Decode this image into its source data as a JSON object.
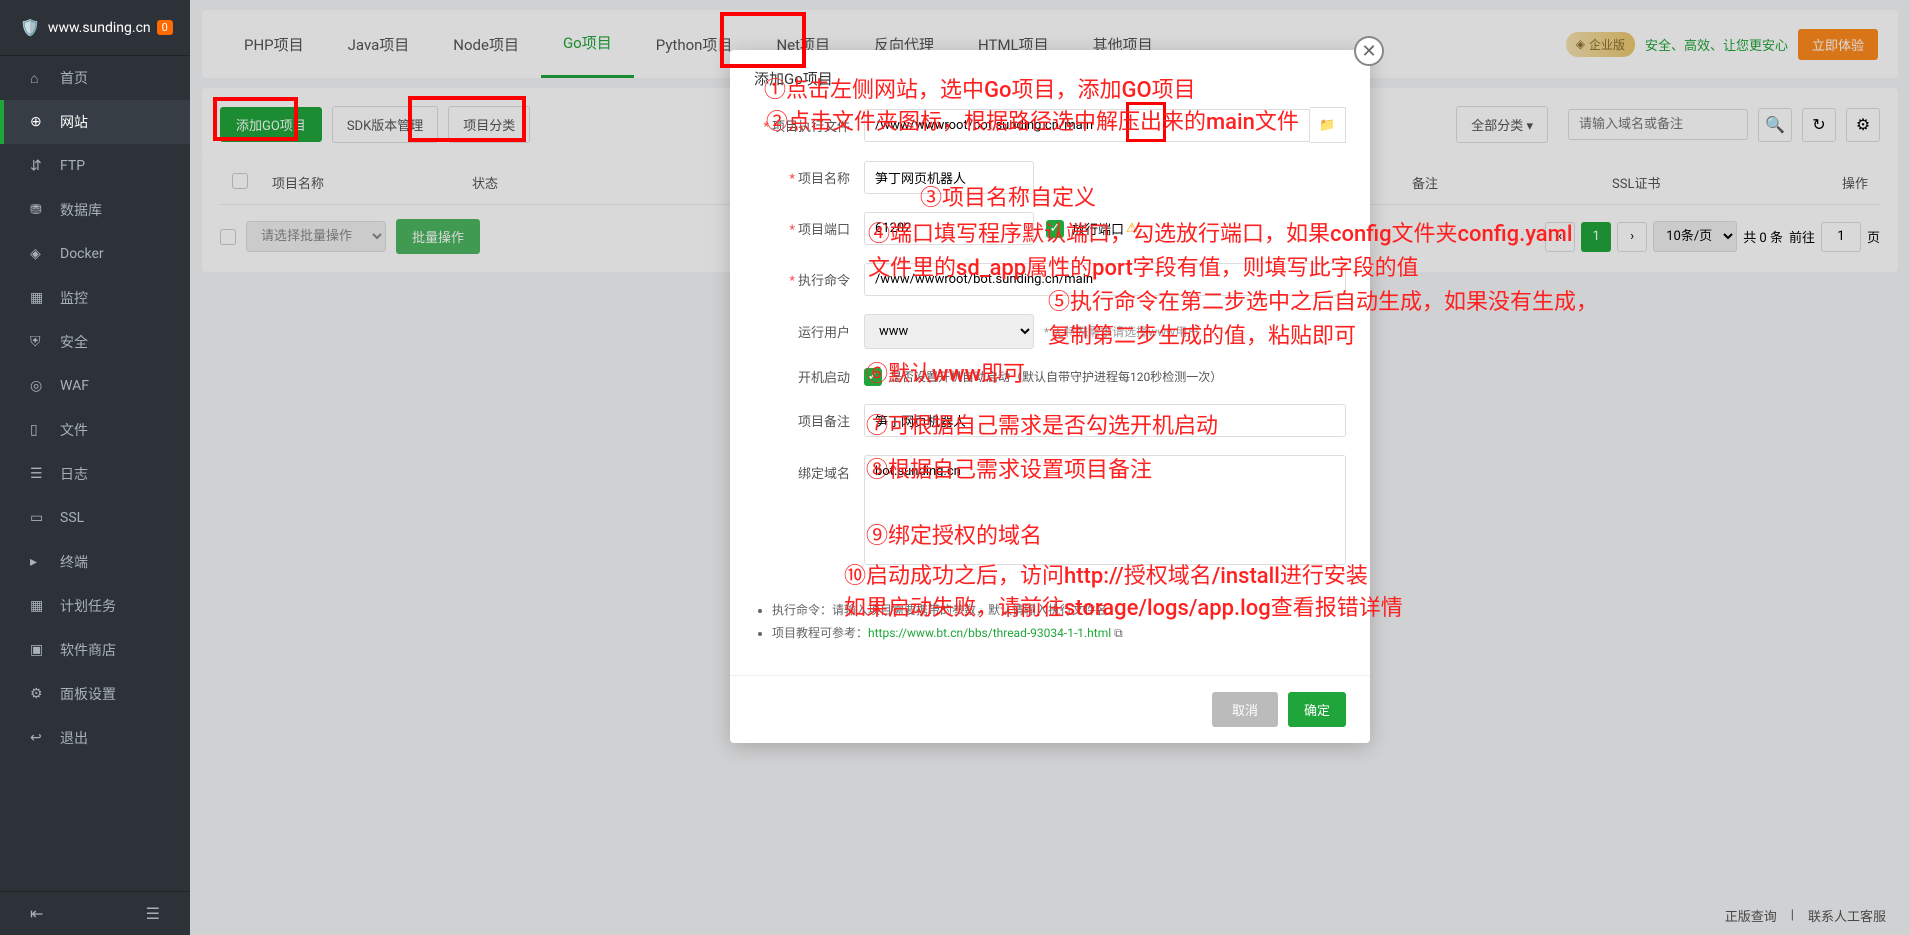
{
  "header": {
    "site": "www.sunding.cn",
    "badge": "0"
  },
  "sidebar": {
    "items": [
      {
        "label": "首页"
      },
      {
        "label": "网站"
      },
      {
        "label": "FTP"
      },
      {
        "label": "数据库"
      },
      {
        "label": "Docker"
      },
      {
        "label": "监控"
      },
      {
        "label": "安全"
      },
      {
        "label": "WAF"
      },
      {
        "label": "文件"
      },
      {
        "label": "日志"
      },
      {
        "label": "SSL"
      },
      {
        "label": "终端"
      },
      {
        "label": "计划任务"
      },
      {
        "label": "软件商店"
      },
      {
        "label": "面板设置"
      },
      {
        "label": "退出"
      }
    ]
  },
  "tabs": [
    "PHP项目",
    "Java项目",
    "Node项目",
    "Go项目",
    "Python项目",
    "Net项目",
    "反向代理",
    "HTML项目",
    "其他项目"
  ],
  "promo": {
    "badge": "企业版",
    "text": "安全、高效、让您更安心",
    "btn": "立即体验"
  },
  "toolbar": {
    "add": "添加GO项目",
    "sdk": "SDK版本管理",
    "cat": "项目分类",
    "allcat": "全部分类",
    "search_ph": "请输入域名或备注"
  },
  "table": {
    "headers": [
      "项目名称",
      "状态",
      "备注",
      "SSL证书",
      "操作"
    ]
  },
  "batch": {
    "ph": "请选择批量操作",
    "btn": "批量操作"
  },
  "pager": {
    "size": "10条/页",
    "total": "共 0 条",
    "goto": "前往",
    "page": "1",
    "unit": "页"
  },
  "modal": {
    "title": "添加Go项目",
    "labels": {
      "exec": "项目执行文件",
      "name": "项目名称",
      "port": "项目端口",
      "cmd": "执行命令",
      "user": "运行用户",
      "boot": "开机启动",
      "remark": "项目备注",
      "domain": "绑定域名"
    },
    "values": {
      "exec": "/www/wwwroot/bot.sunding.cn/main",
      "name": "笋丁网页机器人",
      "port": "61202",
      "port_chk": "放行端口",
      "cmd": "/www/wwwroot/bot.sunding.cn/main",
      "user": "www",
      "user_hint": "* 无特殊需求请选择www用户",
      "boot_hint": "是否设置开机自动启动（默认自带守护进程每120秒检测一次）",
      "remark": "笋丁网页机器人",
      "domain": "bot.sunding.cn"
    },
    "notes": {
      "n1": "执行命令：请输入项目需要携带的参数，默认请输入执行文件名",
      "n2": "项目教程可参考：",
      "link": "https://www.bt.cn/bbs/thread-93034-1-1.html"
    },
    "cancel": "取消",
    "confirm": "确定"
  },
  "anno": {
    "a1": "①点击左侧网站，选中Go项目，添加GO项目",
    "a2": "②点击文件夹图标，根据路径选中解压出来的main文件",
    "a3": "③项目名称自定义",
    "a4a": "④端口填写程序默认端口，勾选放行端口，如果config文件夹config.yaml",
    "a4b": "文件里的sd_app属性的port字段有值，则填写此字段的值",
    "a5a": "⑤执行命令在第二步选中之后自动生成，如果没有生成，",
    "a5b": "复制第二步生成的值，粘贴即可",
    "a6": "⑥默认www即可",
    "a7": "⑦可根据自己需求是否勾选开机启动",
    "a8": "⑧根据自己需求设置项目备注",
    "a9": "⑨绑定授权的域名",
    "a10a": "⑩启动成功之后，访问http://授权域名/install进行安装",
    "a10b": "如果启动失败，请前往storage/logs/app.log查看报错详情"
  },
  "bottom": {
    "a": "正版查询",
    "b": "联系人工客服"
  }
}
